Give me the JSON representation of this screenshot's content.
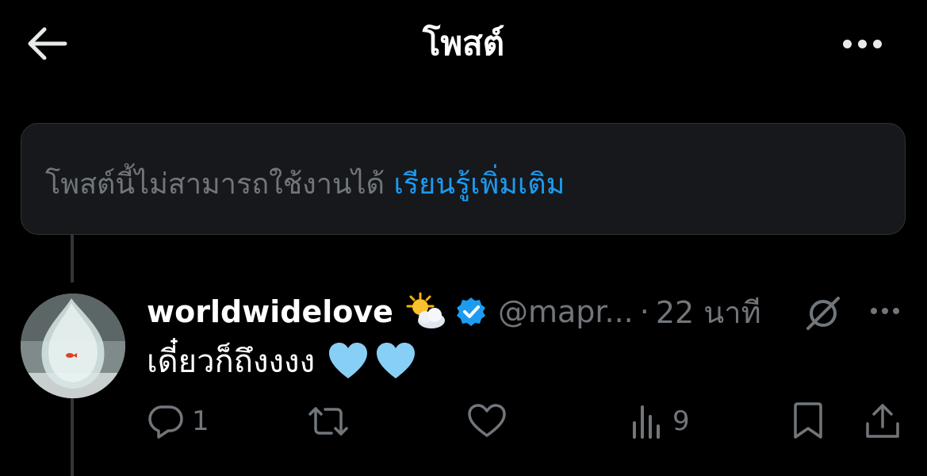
{
  "header": {
    "title": "โพสต์"
  },
  "notice": {
    "text": "โพสต์นี้ไม่สามารถใช้งานได้ ",
    "link": "เรียนรู้เพิ่มเติม"
  },
  "tweet": {
    "display_name": "worldwidelove",
    "handle": "@mapr...",
    "separator": "·",
    "time": "22 นาที",
    "text": "เดี๋ยวก็ถึงงงง",
    "emoji_icon": "sun-behind-cloud-icon",
    "heart_icon": "light-blue-heart-icon"
  },
  "actions": {
    "replies": "1",
    "retweets": "",
    "likes": "",
    "views": "9"
  },
  "colors": {
    "background": "#000000",
    "accent": "#1d9bf0",
    "muted": "#71767b",
    "heart": "#87cff5"
  }
}
